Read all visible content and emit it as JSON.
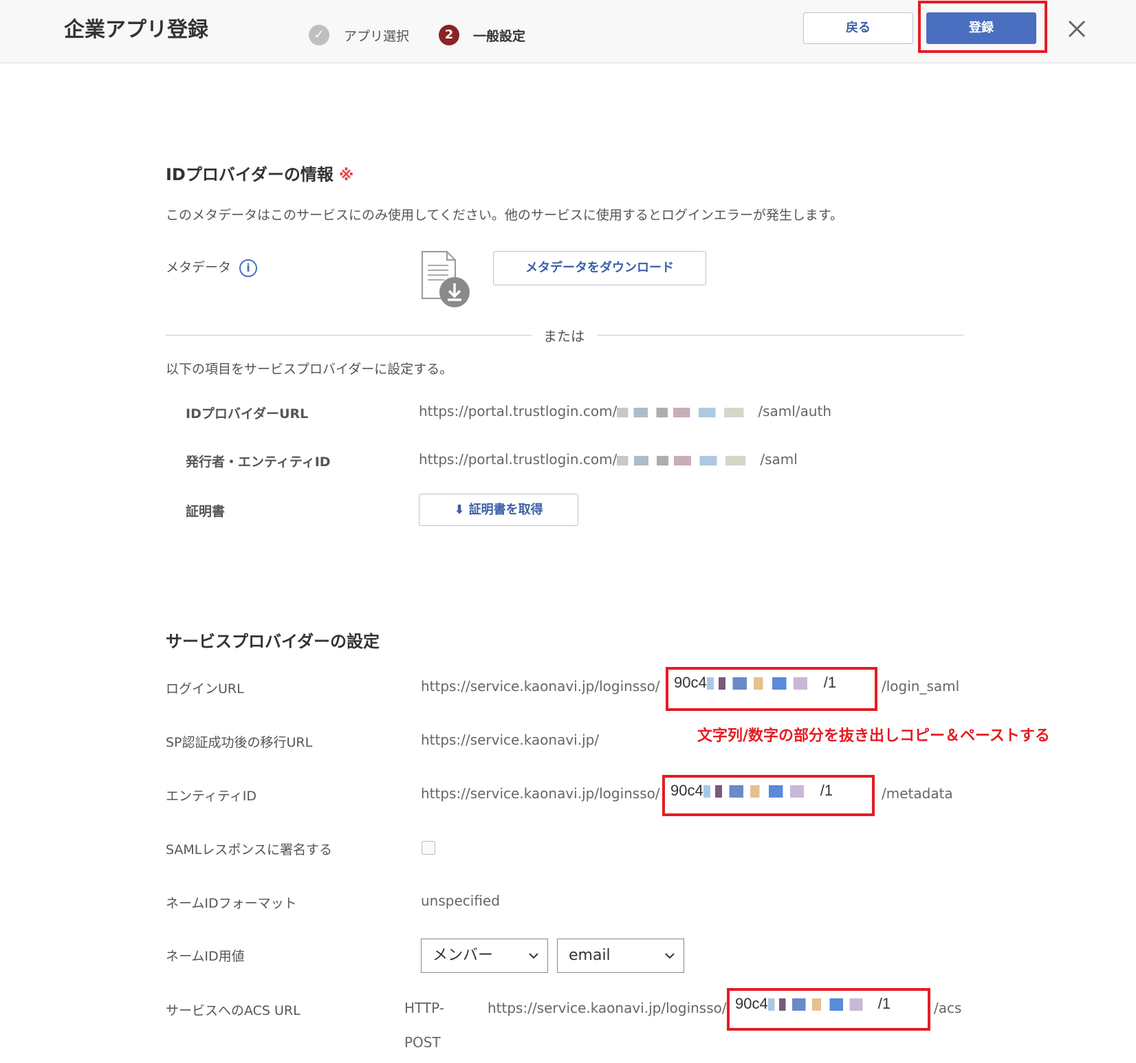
{
  "header": {
    "title": "企業アプリ登録",
    "steps": [
      {
        "label": "アプリ選択",
        "marker": "✓"
      },
      {
        "label": "一般設定",
        "marker": "2"
      }
    ],
    "back_label": "戻る",
    "register_label": "登録"
  },
  "idp": {
    "title": "IDプロバイダーの情報",
    "required_mark": "※",
    "description": "このメタデータはこのサービスにのみ使用してください。他のサービスに使用するとログインエラーが発生します。",
    "metadata_label": "メタデータ",
    "info_icon": "i",
    "download_metadata_label": "メタデータをダウンロード",
    "or_label": "または",
    "instruction": "以下の項目をサービスプロバイダーに設定する。",
    "fields": [
      {
        "label": "IDプロバイダーURL",
        "prefix": "https://portal.trustlogin.com/",
        "suffix": "/saml/auth"
      },
      {
        "label": "発行者・エンティティID",
        "prefix": "https://portal.trustlogin.com/",
        "suffix": "/saml"
      }
    ],
    "certificate_label": "証明書",
    "get_certificate_label": "証明書を取得"
  },
  "sp": {
    "title": "サービスプロバイダーの設定",
    "login_url_label": "ログインURL",
    "login_url_prefix": "https://service.kaonavi.jp/loginsso/",
    "login_url_id": "90c4",
    "login_url_id_end": "/1",
    "login_url_suffix": "/login_saml",
    "annotation": "文字列/数字の部分を抜き出しコピー＆ペーストする",
    "redirect_label": "SP認証成功後の移行URL",
    "redirect_value": "https://service.kaonavi.jp/",
    "entity_label": "エンティティID",
    "entity_prefix": "https://service.kaonavi.jp/loginsso/",
    "entity_id": "90c4",
    "entity_id_end": "/1",
    "entity_suffix": "/metadata",
    "sign_label": "SAMLレスポンスに署名する",
    "nameid_format_label": "ネームIDフォーマット",
    "nameid_format_value": "unspecified",
    "nameid_value_label": "ネームID用値",
    "nameid_select1": "メンバー",
    "nameid_select2": "email",
    "acs_label": "サービスへのACS URL",
    "acs_binding_1": "HTTP-",
    "acs_binding_2": "POST",
    "acs_prefix": "https://service.kaonavi.jp/loginsso/",
    "acs_id": "90c4",
    "acs_id_end": "/1",
    "acs_suffix": "/acs"
  },
  "colors": {
    "primary": "#4a6fc0",
    "highlight": "#e41c23",
    "active_step": "#8b2323"
  }
}
